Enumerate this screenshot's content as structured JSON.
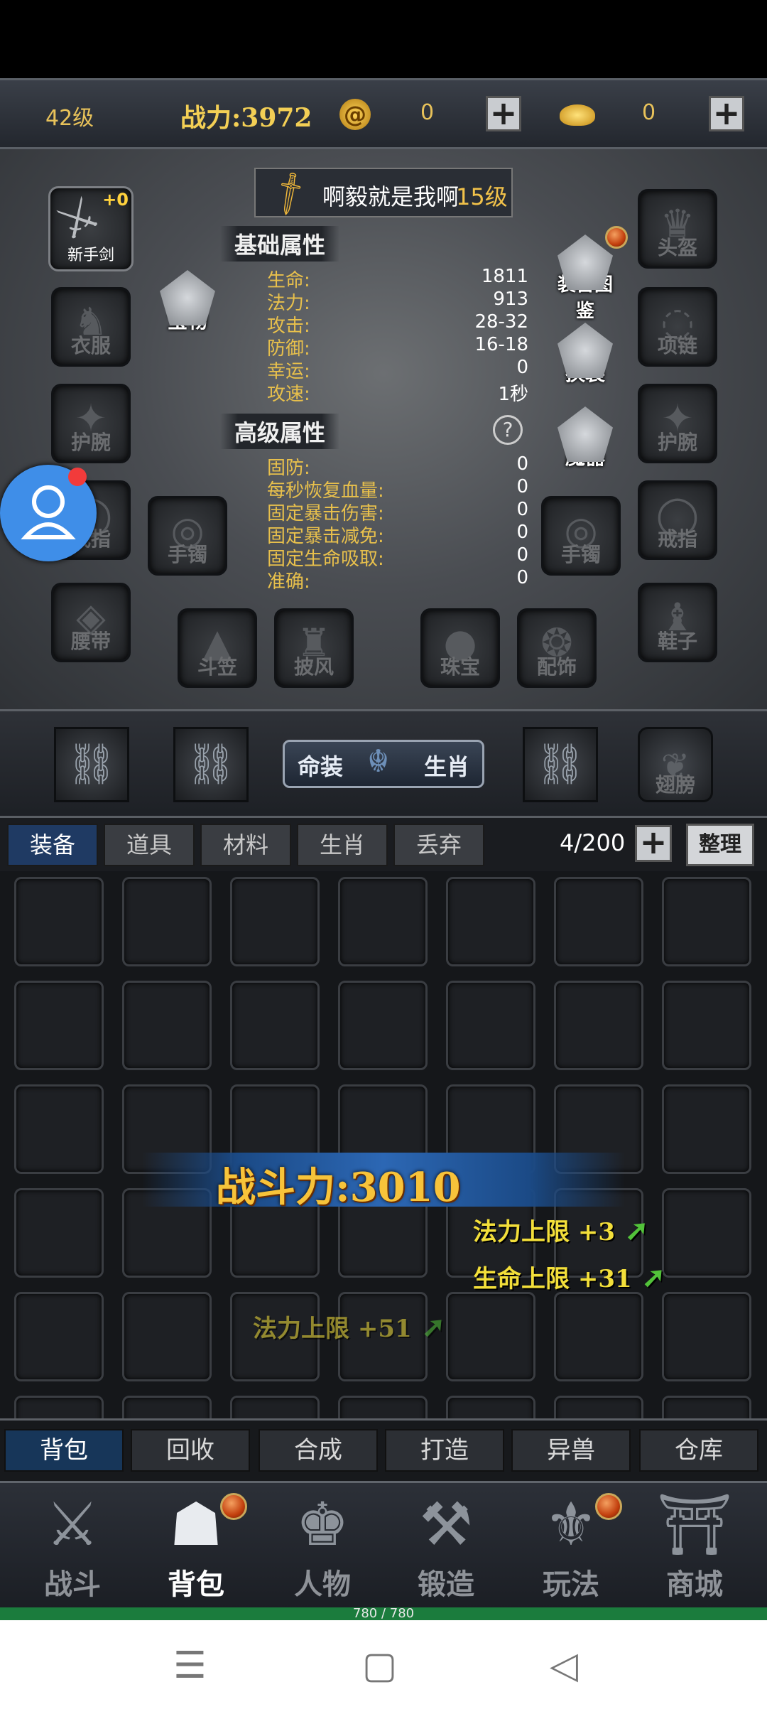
{
  "topbar": {
    "level": "42级",
    "combat_power": "战力:3972",
    "currency1_value": "0",
    "currency2_value": "0",
    "currency1_icon": "spiral-coin-icon",
    "currency2_icon": "gold-ingot-icon"
  },
  "character": {
    "weapon_name": "新手剑",
    "weapon_enhance": "+0",
    "name_prefix": "啊毅就是我啊",
    "name_level": "15级",
    "treasure_label": "宝物",
    "equip_guide_label": "装备图鉴",
    "swap_label": "换装",
    "magic_label": "魔器",
    "basic_title": "基础属性",
    "advanced_title": "高级属性",
    "help_icon": "question-icon",
    "basic_attrs": [
      {
        "k": "生命:",
        "v": "1811"
      },
      {
        "k": "法力:",
        "v": "913"
      },
      {
        "k": "攻击:",
        "v": "28-32"
      },
      {
        "k": "防御:",
        "v": "16-18"
      },
      {
        "k": "幸运:",
        "v": "0"
      },
      {
        "k": "攻速:",
        "v": "1秒"
      }
    ],
    "advanced_attrs": [
      {
        "k": "固防:",
        "v": "0"
      },
      {
        "k": "每秒恢复血量:",
        "v": "0"
      },
      {
        "k": "固定暴击伤害:",
        "v": "0"
      },
      {
        "k": "固定暴击减免:",
        "v": "0"
      },
      {
        "k": "固定生命吸取:",
        "v": "0"
      },
      {
        "k": "准确:",
        "v": "0"
      }
    ],
    "slots": {
      "clothes": "衣服",
      "bracer_left": "护腕",
      "ring_left": "戒指",
      "bracelet_left": "手镯",
      "belt": "腰带",
      "hat": "斗笠",
      "cloak": "披风",
      "jewel": "珠宝",
      "accessory": "配饰",
      "helmet": "头盔",
      "necklace": "项链",
      "bracer_right": "护腕",
      "bracelet_right": "手镯",
      "ring_right": "戒指",
      "shoes": "鞋子"
    }
  },
  "zodiac_row": {
    "ming_label": "命装",
    "zodiac_label": "生肖",
    "wings_label": "翅膀"
  },
  "bag": {
    "tabs": [
      "装备",
      "道具",
      "材料",
      "生肖",
      "丢弃"
    ],
    "capacity": "4/200",
    "sort_label": "整理"
  },
  "popups": {
    "power": "战斗力:3010",
    "mana_up_3": "法力上限 +3",
    "hp_up_31": "生命上限 +31",
    "mana_up_51": "法力上限 +51"
  },
  "subtabs": [
    "背包",
    "回收",
    "合成",
    "打造",
    "异兽",
    "仓库"
  ],
  "nav": [
    {
      "label": "战斗",
      "icon": "crossed-swords-icon"
    },
    {
      "label": "背包",
      "icon": "backpack-icon"
    },
    {
      "label": "人物",
      "icon": "warrior-helmet-icon"
    },
    {
      "label": "锻造",
      "icon": "anvil-icon"
    },
    {
      "label": "玩法",
      "icon": "winged-sword-icon"
    },
    {
      "label": "商城",
      "icon": "pavilion-icon"
    }
  ],
  "hp_text": "780 / 780",
  "colors": {
    "gold_text": "#e8c25a",
    "active_tab": "#1f3a63",
    "hp_bar": "#1b7c3d"
  }
}
